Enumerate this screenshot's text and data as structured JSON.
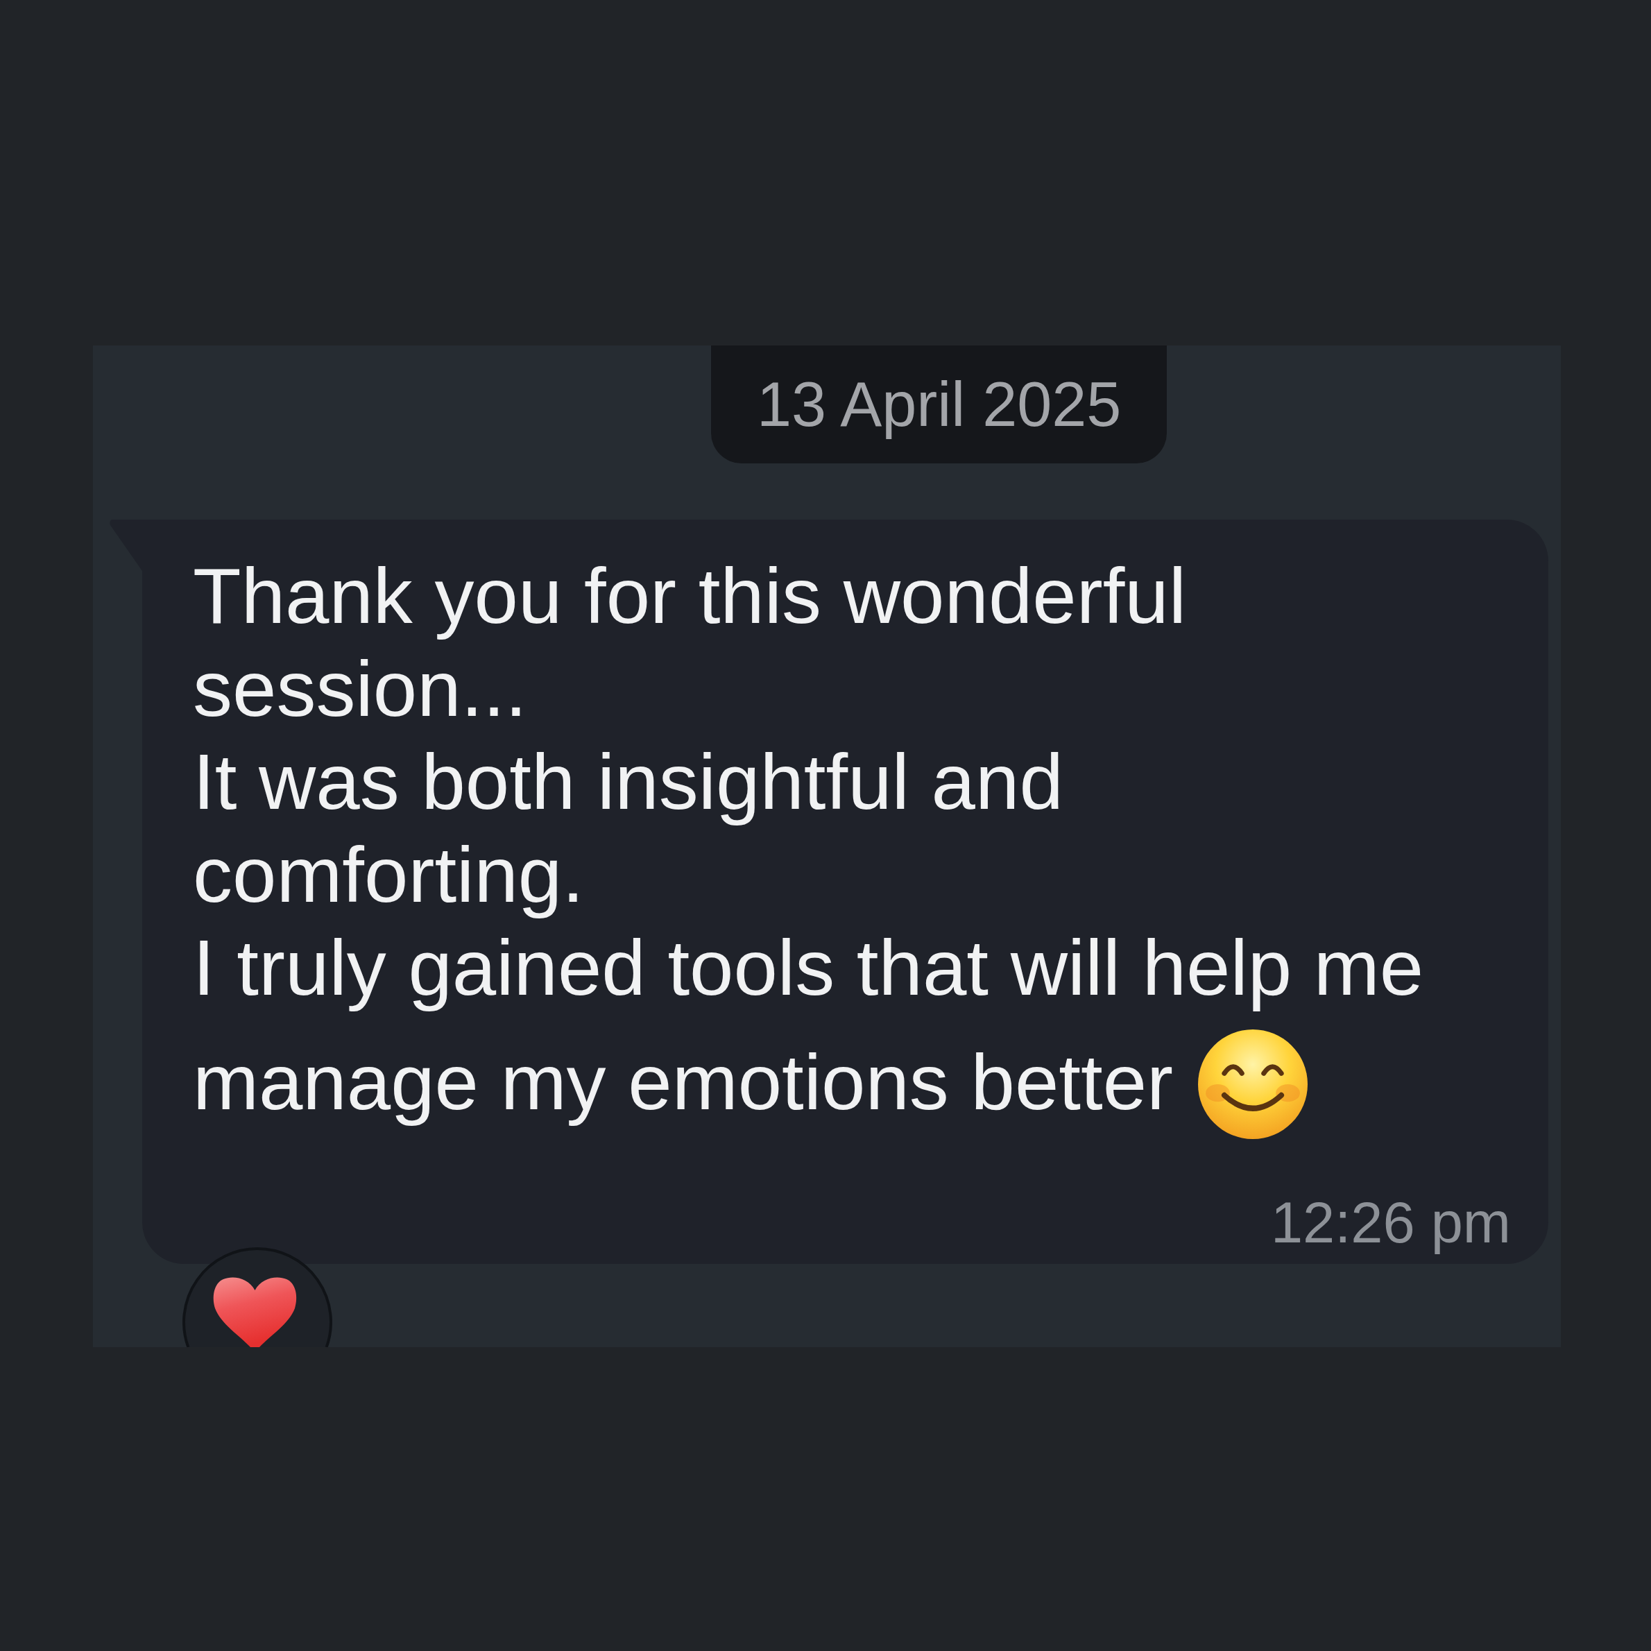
{
  "date_label": "13 April 2025",
  "message": {
    "lines": [
      "Thank you for this wonderful",
      "session...",
      "It was both insightful and",
      "comforting.",
      "I truly gained tools that will help me",
      "manage my emotions better"
    ],
    "time": "12:26 pm"
  }
}
